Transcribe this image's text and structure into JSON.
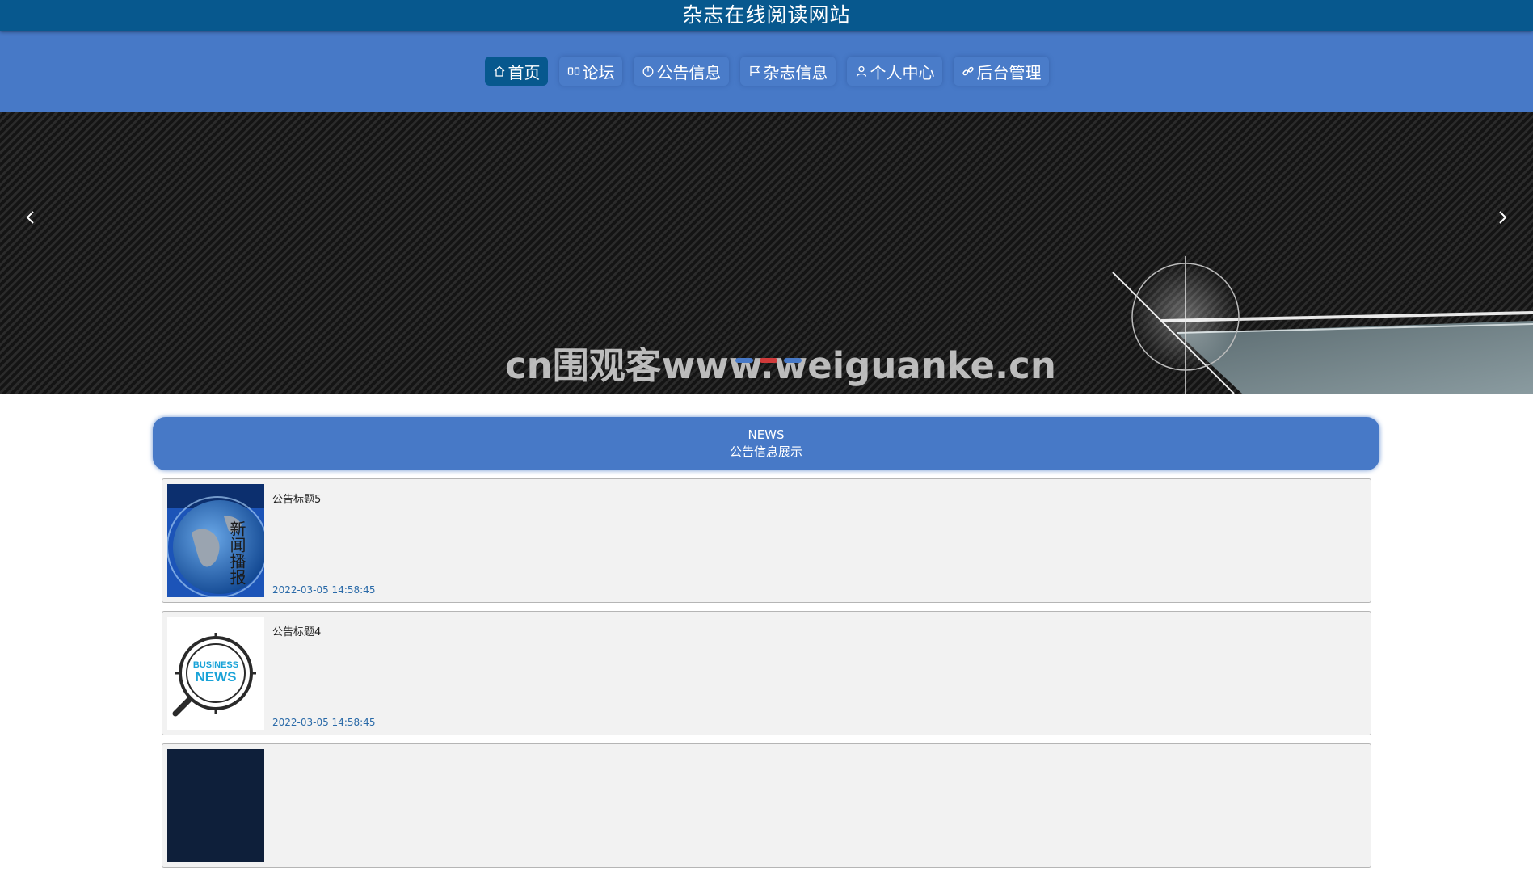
{
  "site": {
    "title": "杂志在线阅读网站"
  },
  "nav": {
    "items": [
      {
        "label": "首页",
        "icon": "home-icon",
        "active": true
      },
      {
        "label": "论坛",
        "icon": "forum-icon",
        "active": false
      },
      {
        "label": "公告信息",
        "icon": "clock-icon",
        "active": false
      },
      {
        "label": "杂志信息",
        "icon": "flag-icon",
        "active": false
      },
      {
        "label": "个人中心",
        "icon": "user-icon",
        "active": false
      },
      {
        "label": "后台管理",
        "icon": "link-icon",
        "active": false
      }
    ]
  },
  "banner": {
    "watermark": "cn围观客www.weiguanke.cn",
    "prev_icon": "chevron-left-icon",
    "next_icon": "chevron-right-icon",
    "slide_count": 3,
    "active_slide": 2
  },
  "news": {
    "heading_en": "NEWS",
    "heading_cn": "公告信息展示",
    "items": [
      {
        "title": "公告标题5",
        "time": "2022-03-05 14:58:45",
        "thumb_text": "新闻播报"
      },
      {
        "title": "公告标题4",
        "time": "2022-03-05 14:58:45",
        "thumb_text_top": "BUSINESS",
        "thumb_text_bottom": "NEWS"
      }
    ]
  },
  "colors": {
    "topbar": "#07588e",
    "navbar": "#4779c7",
    "accent": "#d03a3a"
  }
}
